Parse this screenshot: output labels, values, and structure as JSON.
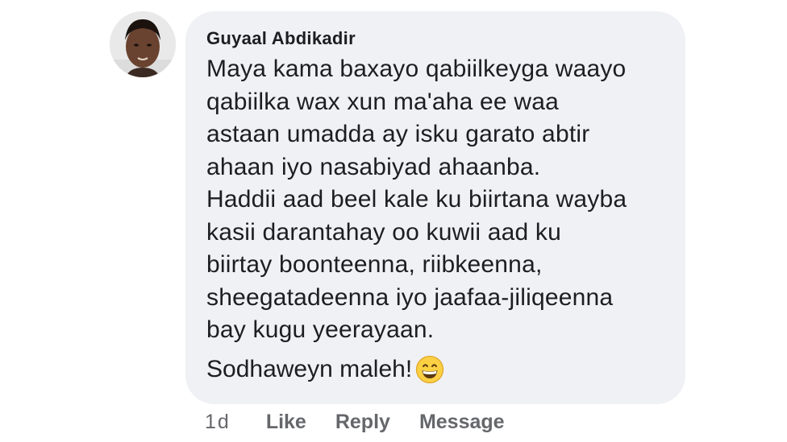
{
  "comment": {
    "author": "Guyaal Abdikadir",
    "lines": [
      "Maya kama baxayo qabiilkeyga waayo",
      "qabiilka wax xun ma'aha ee waa",
      "astaan umadda ay isku garato abtir",
      "ahaan iyo nasabiyad ahaanba.",
      "Haddii aad beel kale ku biirtana wayba",
      "kasii darantahay oo kuwii aad ku",
      "biirtay boonteenna, riibkeenna,",
      "sheegatadeenna iyo jaafaa-jiliqeenna",
      "bay kugu yeerayaan."
    ],
    "last_line": "Sodhaweyn maleh!",
    "emoji": "grinning-face-icon"
  },
  "actions": {
    "time": "1d",
    "like": "Like",
    "reply": "Reply",
    "message": "Message"
  },
  "colors": {
    "bubble": "#f0f1f4",
    "text": "#1c1e21",
    "meta": "#65676b"
  }
}
